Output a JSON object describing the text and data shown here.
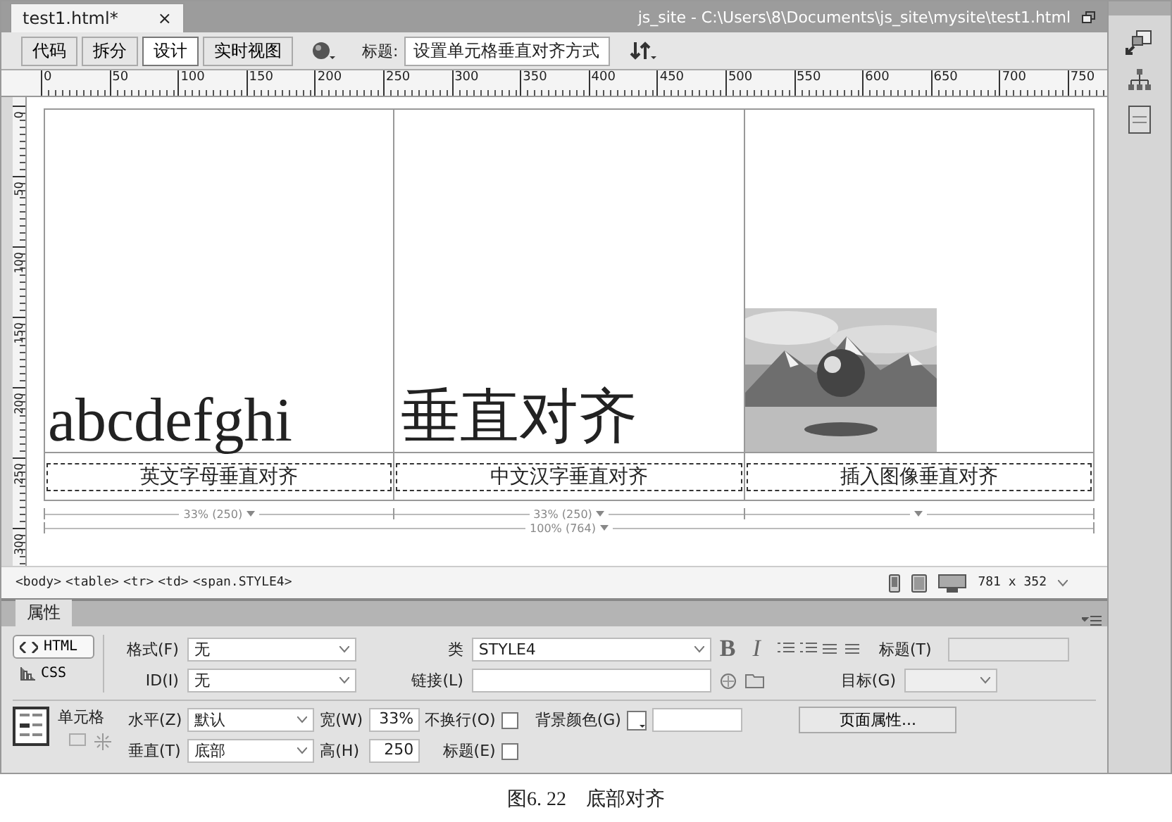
{
  "document_tab": {
    "label": "test1.html*",
    "close": "×"
  },
  "window_path": "js_site - C:\\Users\\8\\Documents\\js_site\\mysite\\test1.html",
  "view_buttons": [
    {
      "label": "代码",
      "selected": false
    },
    {
      "label": "拆分",
      "selected": false
    },
    {
      "label": "设计",
      "selected": true
    },
    {
      "label": "实时视图",
      "selected": false
    }
  ],
  "title_label": "标题:",
  "title_value": "设置单元格垂直对齐方式",
  "ruler_labels": [
    "0",
    "50",
    "100",
    "150",
    "200",
    "250",
    "300",
    "350",
    "400",
    "450",
    "500",
    "550",
    "600",
    "650",
    "700",
    "750"
  ],
  "vertical_ruler_labels": [
    "0",
    "50",
    "100",
    "150",
    "200",
    "250",
    "300"
  ],
  "table": {
    "cells": [
      {
        "kind": "latin",
        "text": "abcdefghi"
      },
      {
        "kind": "cjk",
        "text": "垂直对齐"
      },
      {
        "kind": "picture"
      }
    ],
    "captions": [
      "英文字母垂直对齐",
      "中文汉字垂直对齐",
      "插入图像垂直对齐"
    ],
    "column_widths": [
      "33% (250)",
      "33% (250)"
    ],
    "total_width": "100% (764)"
  },
  "tag_path": [
    "<body>",
    "<table>",
    "<tr>",
    "<td>",
    "<span.STYLE4>"
  ],
  "window_size": "781 x 352",
  "properties": {
    "title": "属性",
    "modes": [
      {
        "label": "HTML",
        "selected": true
      },
      {
        "label": "CSS",
        "selected": false
      }
    ],
    "format_label": "格式(F)",
    "format_value": "无",
    "id_label": "ID(I)",
    "id_value": "无",
    "class_label": "类",
    "class_value": "STYLE4",
    "link_label": "链接(L)",
    "bold": "B",
    "italic": "I",
    "heading_label": "标题(T)",
    "target_label": "目标(G)",
    "cell_label": "单元格",
    "horz_label": "水平(Z)",
    "horz_value": "默认",
    "vert_label": "垂直(T)",
    "vert_value": "底部",
    "width_label": "宽(W)",
    "width_value": "33%",
    "height_label": "高(H)",
    "height_value": "250",
    "nowrap_label": "不换行(O)",
    "nowrap_checked": false,
    "header_label": "标题(E)",
    "header_checked": false,
    "bgcolor_label": "背景颜色(G)",
    "page_props": "页面属性..."
  },
  "caption": "图6. 22　底部对齐"
}
